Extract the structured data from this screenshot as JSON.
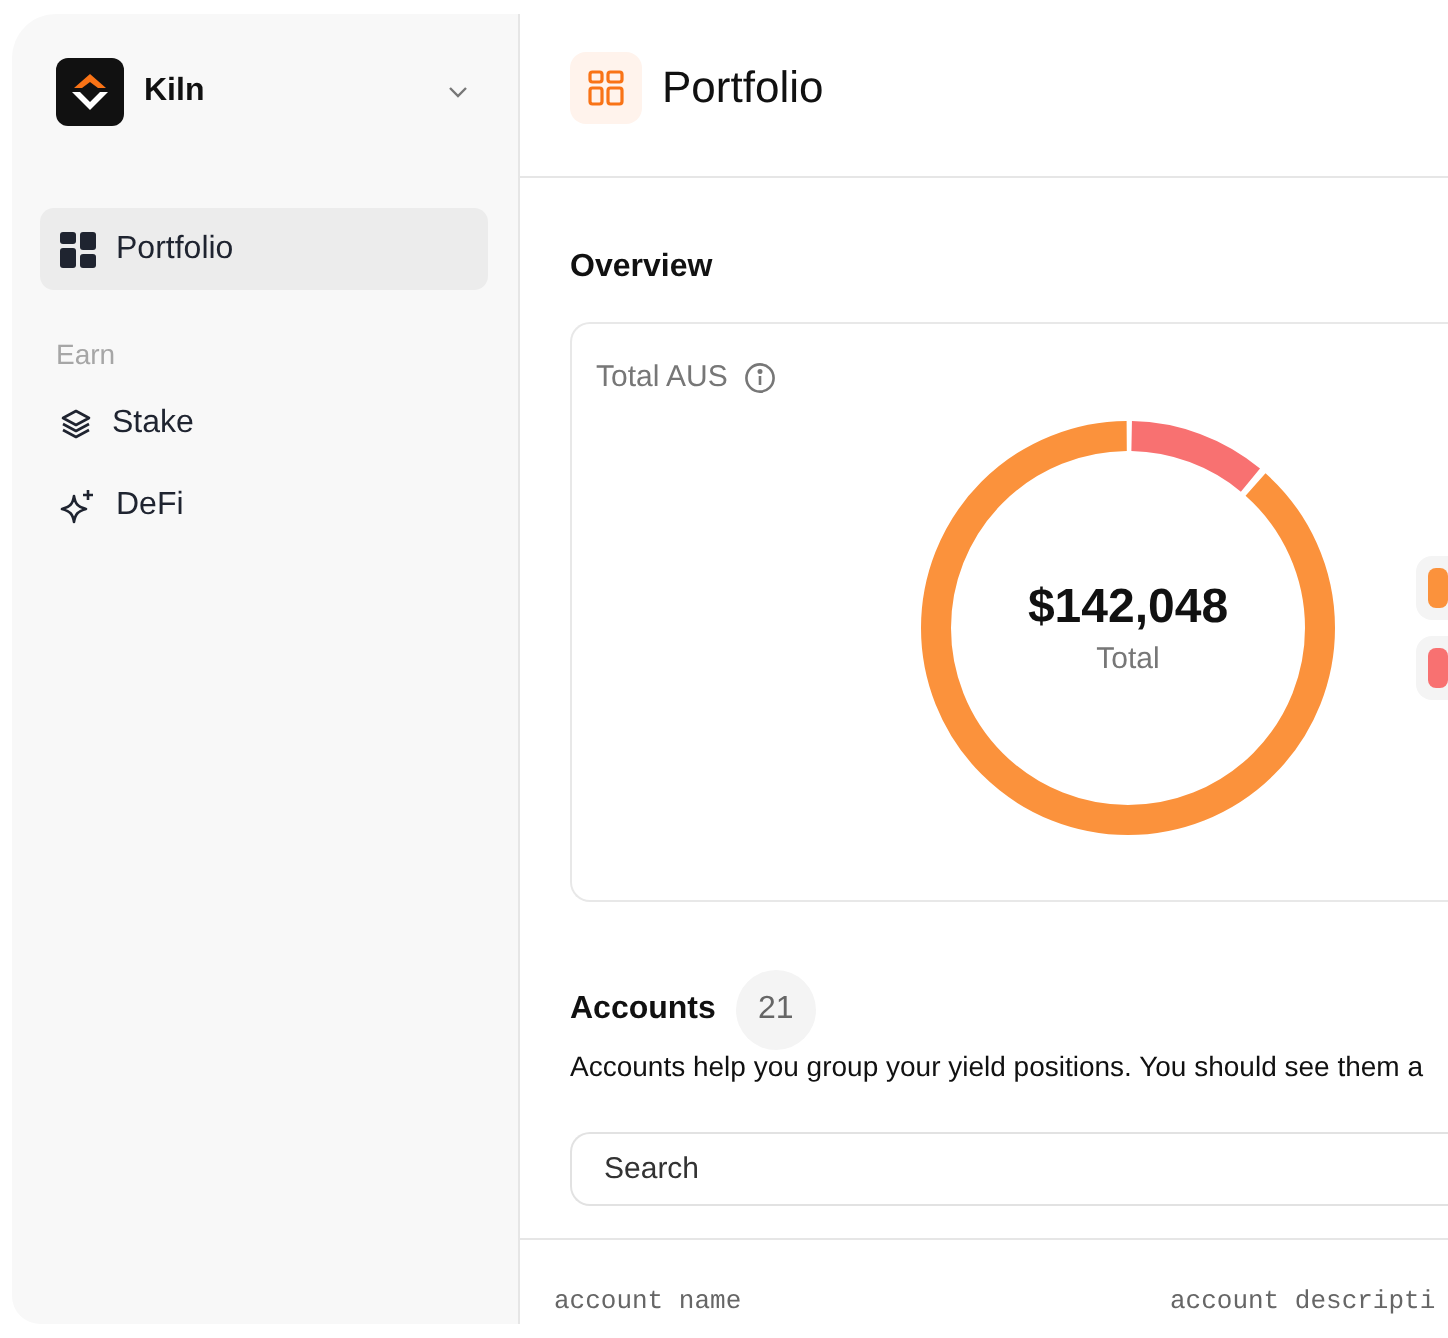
{
  "sidebar": {
    "workspace": "Kiln",
    "nav": [
      {
        "kind": "item",
        "label": "Portfolio",
        "selected": true
      },
      {
        "kind": "section",
        "label": "Earn"
      },
      {
        "kind": "item",
        "label": "Stake",
        "selected": false
      },
      {
        "kind": "item",
        "label": "DeFi",
        "selected": false
      }
    ]
  },
  "header": {
    "title": "Portfolio"
  },
  "overview": {
    "heading": "Overview",
    "card_title": "Total AUS",
    "total": "$142,048",
    "total_label": "Total",
    "legend": [
      {
        "color": "#fb923c"
      },
      {
        "color": "#f87171"
      }
    ]
  },
  "accounts": {
    "heading": "Accounts",
    "count": "21",
    "description": "Accounts help you group your yield positions. You should see them a",
    "search": {
      "placeholder": "Search"
    }
  },
  "table": {
    "columns": [
      "account name",
      "account descripti"
    ]
  }
}
